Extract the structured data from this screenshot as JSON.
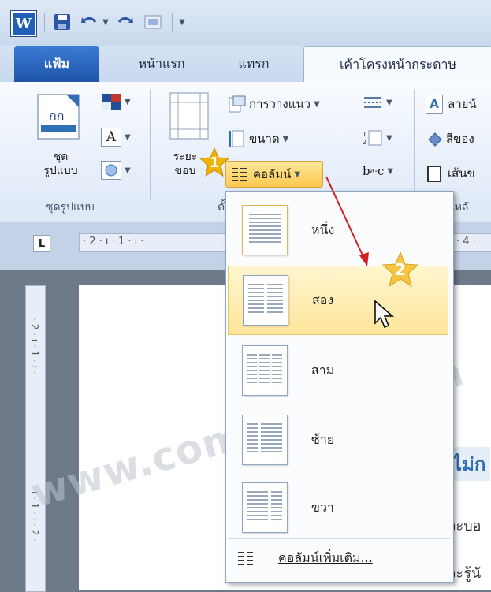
{
  "tabs": {
    "file": "แฟ้ม",
    "home": "หน้าแรก",
    "insert": "แทรก",
    "page_layout": "เค้าโครงหน้ากระดาษ"
  },
  "ribbon": {
    "themes_label": "ชุด\nรูปแบบ",
    "themes_group": "ชุดรูปแบบ",
    "margins_label": "ระยะ\nขอบ",
    "page_setup_group_partial": "ตั้ง",
    "orientation": "การวางแนว",
    "size": "ขนาด",
    "columns": "คอลัมน์",
    "watermark_partial": "ลายน้",
    "page_color_partial": "สีของ",
    "page_border_partial": "เส้นข",
    "page_bg_group_partial": "พื้นหลั"
  },
  "ruler": {
    "h_marks": "· 2 · ı · 1 · ı ·",
    "h_right": "· 4 ·"
  },
  "document": {
    "heading_partial": "ไม่ก",
    "line1_partial": "จะบอ",
    "line2_partial": "จะรู้นั"
  },
  "menu": {
    "items": [
      {
        "label": "หนึ่ง"
      },
      {
        "label": "สอง"
      },
      {
        "label": "สาม"
      },
      {
        "label": "ซ้าย"
      },
      {
        "label": "ขวา"
      }
    ],
    "more": "คอลัมน์เพิ่มเติม..."
  },
  "badges": {
    "step1": "1",
    "step2": "2"
  },
  "watermark": "www.com5dow.com",
  "colors": {
    "accent": "#1f55a8",
    "highlight": "#fde59a",
    "badge": "#f0b400"
  },
  "icons": [
    "word-logo-icon",
    "save-icon",
    "undo-icon",
    "redo-icon",
    "cursor-arrow-icon"
  ]
}
